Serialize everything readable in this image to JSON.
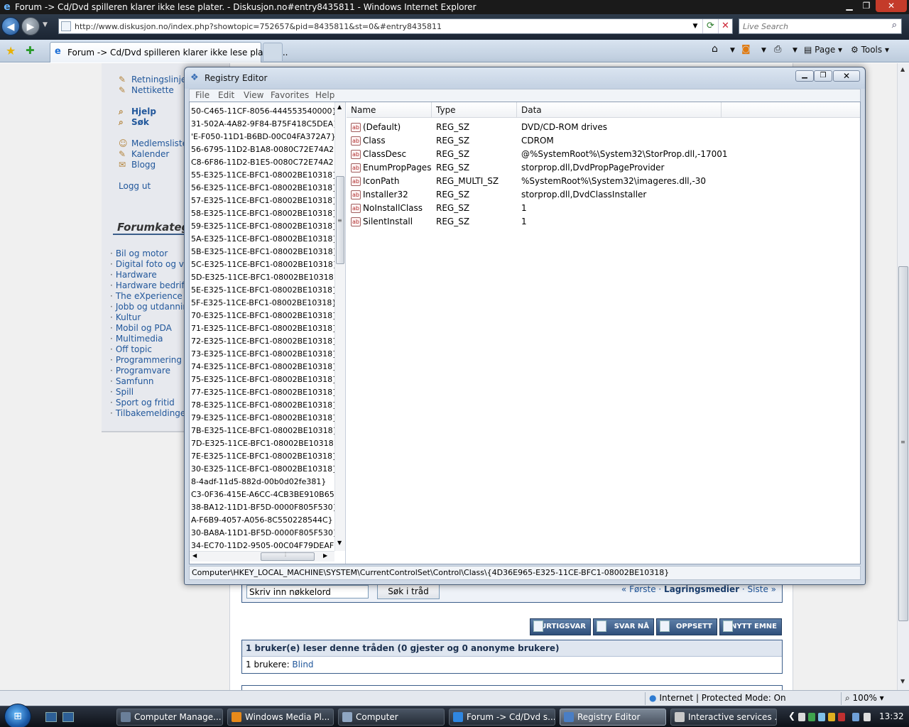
{
  "ie": {
    "title": "Forum -> Cd/Dvd spilleren klarer ikke lese plater. - Diskusjon.no#entry8435811 - Windows Internet Explorer",
    "address": "http://www.diskusjon.no/index.php?showtopic=752657&pid=8435811&st=0&#entry8435811",
    "search_placeholder": "Live Search",
    "tab_label": "Forum -> Cd/Dvd spilleren klarer ikke lese plater. ...",
    "page_label": "Page",
    "tools_label": "Tools",
    "status_zone": "Internet | Protected Mode: On",
    "zoom": "100%"
  },
  "forum": {
    "sidebar_links": [
      {
        "label": "Retningslinje"
      },
      {
        "label": "Nettikette"
      },
      {
        "label": "Hjelp"
      },
      {
        "label": "Søk"
      },
      {
        "label": "Medlemsliste"
      },
      {
        "label": "Kalender"
      },
      {
        "label": "Blogg"
      },
      {
        "label": "Logg ut"
      }
    ],
    "categories_heading": "Forumkategorier",
    "categories": [
      "Bil og motor",
      "Digital foto og video",
      "Hardware",
      "Hardware bedrift",
      "The eXperience",
      "Jobb og utdanning",
      "Kultur",
      "Mobil og PDA",
      "Multimedia",
      "Off topic",
      "Programmering",
      "Programvare",
      "Samfunn",
      "Spill",
      "Sport og fritid",
      "Tilbakemeldinger"
    ],
    "search_placeholder": "Skriv inn nøkkelord",
    "search_button": "Søk i tråd",
    "crumb_first": "« Første",
    "crumb_current": "Lagringsmedier",
    "crumb_last": "Siste »",
    "crumb_sep": " · ",
    "actions": {
      "quick_reply": "HURTIGSVAR",
      "reply_now": "SVAR NÅ",
      "options": "OPPSETT",
      "new_topic": "NYTT EMNE"
    },
    "readers_heading": "1 bruker(e) leser denne tråden (0 gjester og 0 anonyme brukere)",
    "readers_prefix": "1 brukere: ",
    "readers_name": "Blind"
  },
  "regedit": {
    "title": "Registry Editor",
    "menu": [
      "File",
      "Edit",
      "View",
      "Favorites",
      "Help"
    ],
    "tree": [
      "50-C465-11CF-8056-444553540000}",
      "31-502A-4A82-9F84-B75F418C5DEA}",
      "'E-F050-11D1-B6BD-00C04FA372A7}",
      "56-6795-11D2-B1A8-0080C72E74A2}",
      "C8-6F86-11D2-B1E5-0080C72E74A2}",
      "55-E325-11CE-BFC1-08002BE10318}",
      "56-E325-11CE-BFC1-08002BE10318}",
      "57-E325-11CE-BFC1-08002BE10318}",
      "58-E325-11CE-BFC1-08002BE10318}",
      "59-E325-11CE-BFC1-08002BE10318}",
      "5A-E325-11CE-BFC1-08002BE10318}",
      "5B-E325-11CE-BFC1-08002BE10318}",
      "5C-E325-11CE-BFC1-08002BE10318}",
      "5D-E325-11CE-BFC1-08002BE10318}",
      "5E-E325-11CE-BFC1-08002BE10318}",
      "5F-E325-11CE-BFC1-08002BE10318}",
      "70-E325-11CE-BFC1-08002BE10318}",
      "71-E325-11CE-BFC1-08002BE10318}",
      "72-E325-11CE-BFC1-08002BE10318}",
      "73-E325-11CE-BFC1-08002BE10318}",
      "74-E325-11CE-BFC1-08002BE10318}",
      "75-E325-11CE-BFC1-08002BE10318}",
      "77-E325-11CE-BFC1-08002BE10318}",
      "78-E325-11CE-BFC1-08002BE10318}",
      "79-E325-11CE-BFC1-08002BE10318}",
      "7B-E325-11CE-BFC1-08002BE10318}",
      "7D-E325-11CE-BFC1-08002BE10318}",
      "7E-E325-11CE-BFC1-08002BE10318}",
      "30-E325-11CE-BFC1-08002BE10318}",
      "8-4adf-11d5-882d-00b0d02fe381}",
      "C3-0F36-415E-A6CC-4CB3BE910B65}",
      "38-BA12-11D1-BF5D-0000F805F530}",
      "A-F6B9-4057-A056-8C550228544C}",
      "30-BA8A-11D1-BF5D-0000F805F530}",
      "34-EC70-11D2-9505-00C04F79DEAF}"
    ],
    "columns": {
      "name": "Name",
      "type": "Type",
      "data": "Data"
    },
    "values": [
      {
        "name": "(Default)",
        "type": "REG_SZ",
        "data": "DVD/CD-ROM drives"
      },
      {
        "name": "Class",
        "type": "REG_SZ",
        "data": "CDROM"
      },
      {
        "name": "ClassDesc",
        "type": "REG_SZ",
        "data": "@%SystemRoot%\\System32\\StorProp.dll,-17001"
      },
      {
        "name": "EnumPropPages...",
        "type": "REG_SZ",
        "data": "storprop.dll,DvdPropPageProvider"
      },
      {
        "name": "IconPath",
        "type": "REG_MULTI_SZ",
        "data": "%SystemRoot%\\System32\\imageres.dll,-30"
      },
      {
        "name": "Installer32",
        "type": "REG_SZ",
        "data": "storprop.dll,DvdClassInstaller"
      },
      {
        "name": "NoInstallClass",
        "type": "REG_SZ",
        "data": "1"
      },
      {
        "name": "SilentInstall",
        "type": "REG_SZ",
        "data": "1"
      }
    ],
    "status_path": "Computer\\HKEY_LOCAL_MACHINE\\SYSTEM\\CurrentControlSet\\Control\\Class\\{4D36E965-E325-11CE-BFC1-08002BE10318}"
  },
  "taskbar": {
    "tasks": [
      "Computer Manage...",
      "Windows Media Pl...",
      "Computer",
      "Forum -> Cd/Dvd s...",
      "Registry Editor",
      "Interactive services ..."
    ],
    "clock": "13:32"
  }
}
